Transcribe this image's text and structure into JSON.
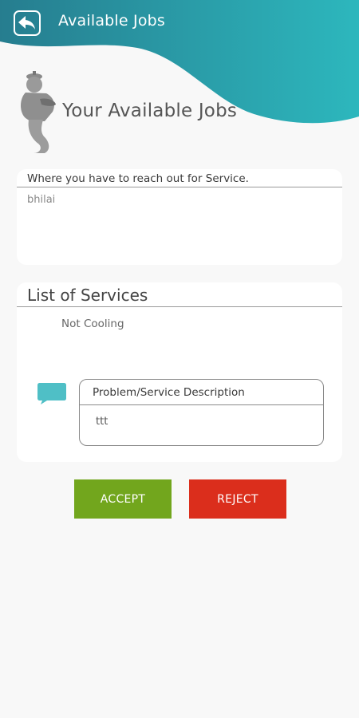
{
  "header": {
    "title": "Available Jobs",
    "background_color": "#26a6ad",
    "back_icon": "back-arrow-icon"
  },
  "page": {
    "heading": "Your Available Jobs",
    "mascot_icon": "genie-icon"
  },
  "location": {
    "label": "Where you have to reach out for Service.",
    "value": "bhilai"
  },
  "services": {
    "title": "List of Services",
    "items": [
      "Not Cooling"
    ],
    "description_label": "Problem/Service Description",
    "description_value": "ttt",
    "chat_icon": "chat-icon",
    "chat_icon_color": "#4fbfc6"
  },
  "actions": {
    "accept_label": "ACCEPT",
    "accept_color": "#72a61d",
    "reject_label": "REJECT",
    "reject_color": "#db2e1c"
  }
}
